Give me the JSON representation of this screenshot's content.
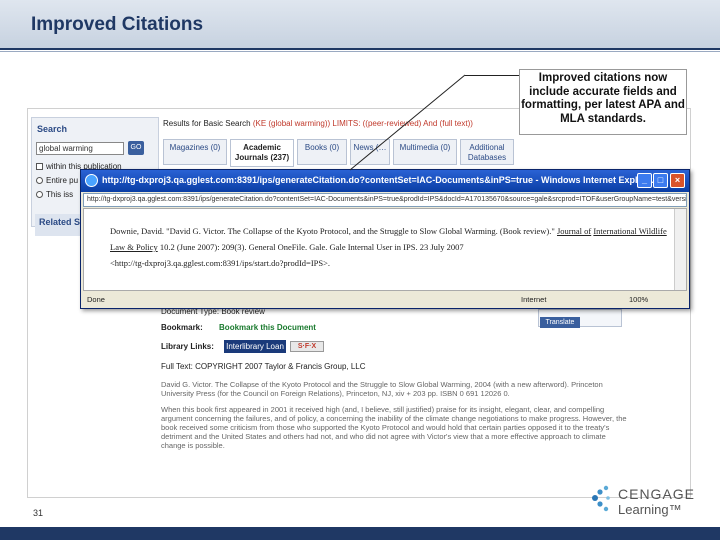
{
  "slide": {
    "title": "Improved Citations",
    "page_number": "31",
    "callout": "Improved citations now include accurate fields and formatting, per latest APA and MLA standards."
  },
  "logo": {
    "line1": "CENGAGE",
    "line2": "Learning™"
  },
  "background_page": {
    "search_title": "Search",
    "search_value": "global warming",
    "go_label": "GO",
    "options": [
      "within this publication",
      "Entire pu",
      "This iss"
    ],
    "related_title": "Related S",
    "results_prefix": "Results for Basic Search",
    "results_query": "(KE (global warming)) LIMITS: ((peer-reviewed) And (full text))",
    "tabs": [
      {
        "label": "Magazines (0)"
      },
      {
        "label": "Academic Journals (237)"
      },
      {
        "label": "Books (0)"
      },
      {
        "label": "News (…"
      },
      {
        "label": "Multimedia (0)"
      },
      {
        "label": "Additional Databases"
      }
    ],
    "doc_type": "Document Type: Book review",
    "bookmark_label": "Bookmark:",
    "bookmark_link": "Bookmark this Document",
    "library_links": "Library Links:",
    "ill_label": "Interlibrary Loan",
    "sfx_label": "S·F·X",
    "translate_label": "Translate",
    "full_text": "Full Text: COPYRIGHT 2007 Taylor & Francis Group, LLC",
    "body_para1": "David G. Victor. The Collapse of the Kyoto Protocol and the Struggle to Slow Global Warming, 2004 (with a new afterword). Princeton University Press (for the Council on Foreign Relations), Princeton, NJ, xiv + 203 pp. ISBN 0 691 12026 0.",
    "body_para2": "When this book first appeared in 2001 it received high (and, I believe, still justified) praise for its insight, elegant, clear, and compelling argument concerning the failures, and of policy, a concerning the inability of the climate change negotiations to make progress. However, the book received some criticism from those who supported the Kyoto Protocol and would hold that certain parties opposed it to the treaty's detriment and the United States and others had not, and who did not agree with Victor's view that a more effective approach to climate change is possible."
  },
  "popup": {
    "title": "http://tg-dxproj3.qa.gglest.com:8391/ips/generateCitation.do?contentSet=IAC-Documents&inPS=true - Windows Internet Explor...",
    "address": "http://tg-dxproj3.qa.gglest.com:8391/ips/generateCitation.do?contentSet=IAC-Documents&inPS=true&prodId=IPS&docId=A170135670&source=gale&srcprod=ITOF&userGroupName=test&version=1.0",
    "citation_part1": "Downie, David. \"David G. Victor. The Collapse of the Kyoto Protocol, and the Struggle to Slow Global Warming. (Book review).\" ",
    "citation_journal1": "Journal of",
    "citation_journal2": "International Wildlife Law & Policy",
    "citation_part2": " 10.2 (June 2007): 209(3). General OneFile. Gale. Gale Internal User in IPS. 23 July 2007",
    "citation_url": "<http://tg-dxproj3.qa.gglest.com:8391/ips/start.do?prodId=IPS>.",
    "status_done": "Done",
    "status_zone": "Internet",
    "status_zoom": "100%"
  }
}
